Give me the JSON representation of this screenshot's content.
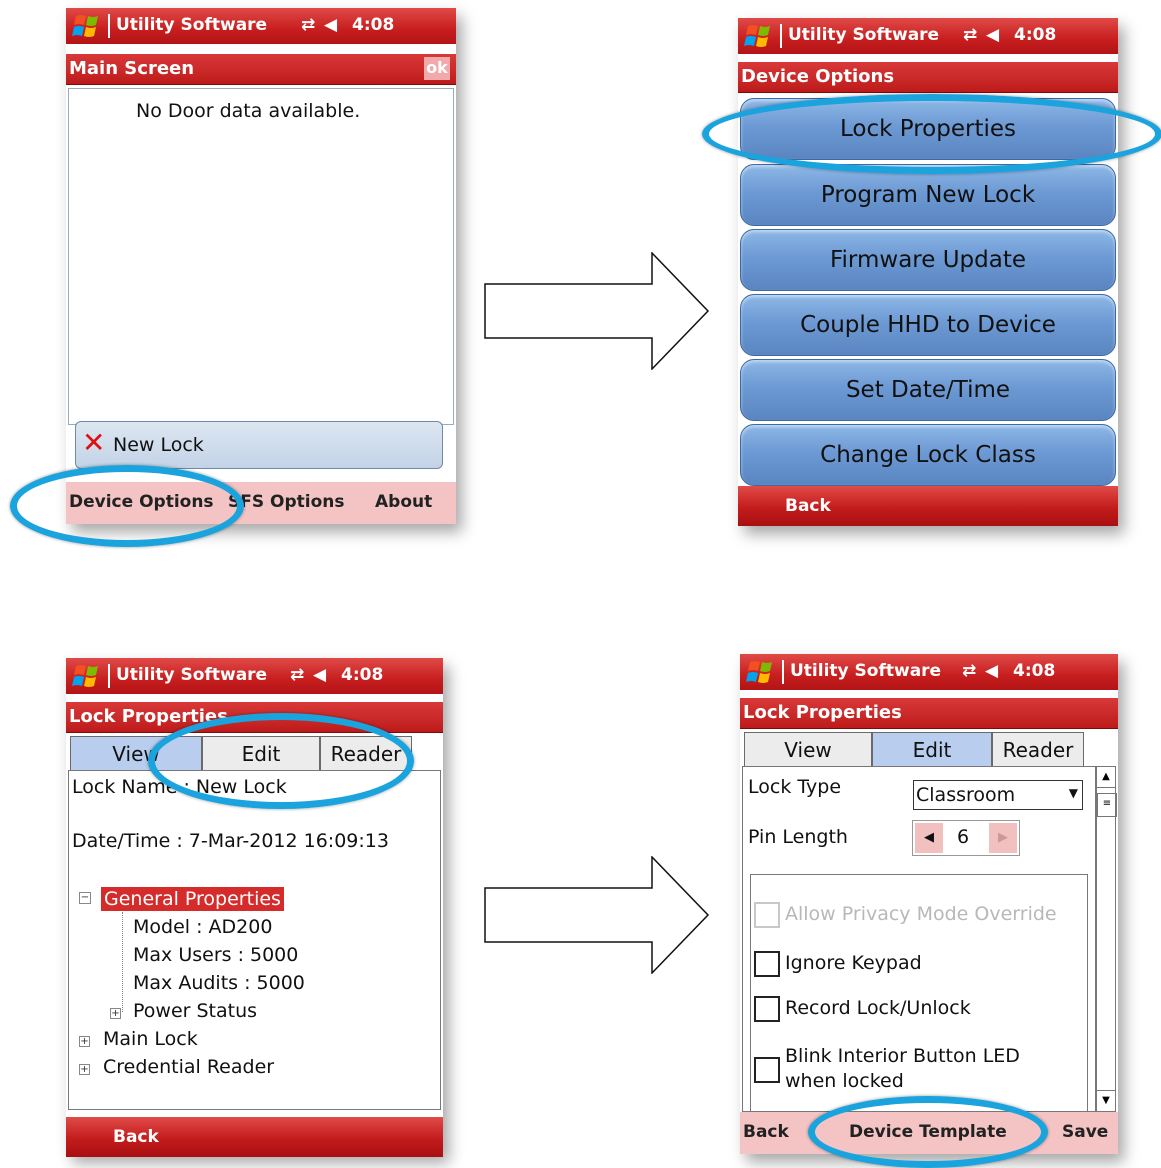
{
  "screens": {
    "main": {
      "app_title": "Utility Software",
      "time": "4:08",
      "subtitle": "Main Screen",
      "ok_label": "ok",
      "message": "No Door data available.",
      "new_lock_label": "New Lock",
      "menu": {
        "device_options": "Device Options",
        "sfs_options": "SFS Options",
        "about": "About"
      }
    },
    "device_options": {
      "app_title": "Utility Software",
      "time": "4:08",
      "subtitle": "Device Options",
      "buttons": [
        "Lock Properties",
        "Program New Lock",
        "Firmware Update",
        "Couple HHD to Device",
        "Set Date/Time",
        "Change Lock Class"
      ],
      "back_label": "Back"
    },
    "lock_view": {
      "app_title": "Utility Software",
      "time": "4:08",
      "subtitle": "Lock Properties",
      "tabs": [
        "View",
        "Edit",
        "Reader"
      ],
      "lock_name": "Lock Name : New Lock",
      "date_time": "Date/Time : 7-Mar-2012  16:09:13",
      "tree": {
        "general": "General Properties",
        "model": "Model : AD200",
        "max_users": "Max Users : 5000",
        "max_audits": "Max Audits : 5000",
        "power_status": "Power Status",
        "main_lock": "Main Lock",
        "credential_reader": "Credential Reader"
      },
      "back_label": "Back"
    },
    "lock_edit": {
      "app_title": "Utility Software",
      "time": "4:08",
      "subtitle": "Lock Properties",
      "tabs": [
        "View",
        "Edit",
        "Reader"
      ],
      "lock_type_label": "Lock Type",
      "lock_type_value": "Classroom",
      "pin_length_label": "Pin Length",
      "pin_length_value": "6",
      "checkboxes": {
        "privacy": "Allow Privacy Mode Override",
        "keypad": "Ignore Keypad",
        "record": "Record Lock/Unlock",
        "blink_1": "Blink Interior Button LED",
        "blink_2": "when locked"
      },
      "menu": {
        "back": "Back",
        "template": "Device Template",
        "save": "Save"
      }
    }
  },
  "colors": {
    "title_red": "#c71e1f",
    "menu_pink": "#f4c4c4",
    "button_blue": "#6d9ad4",
    "highlight_ring": "#1aa3dc",
    "selected_tree": "#d52b2b"
  },
  "icons": [
    "windows-flag-icon",
    "connectivity-icon",
    "speaker-icon",
    "red-x-icon",
    "right-arrow",
    "dropdown-arrow-icon",
    "spinner-left-icon",
    "spinner-right-icon",
    "tree-expander-icon"
  ]
}
